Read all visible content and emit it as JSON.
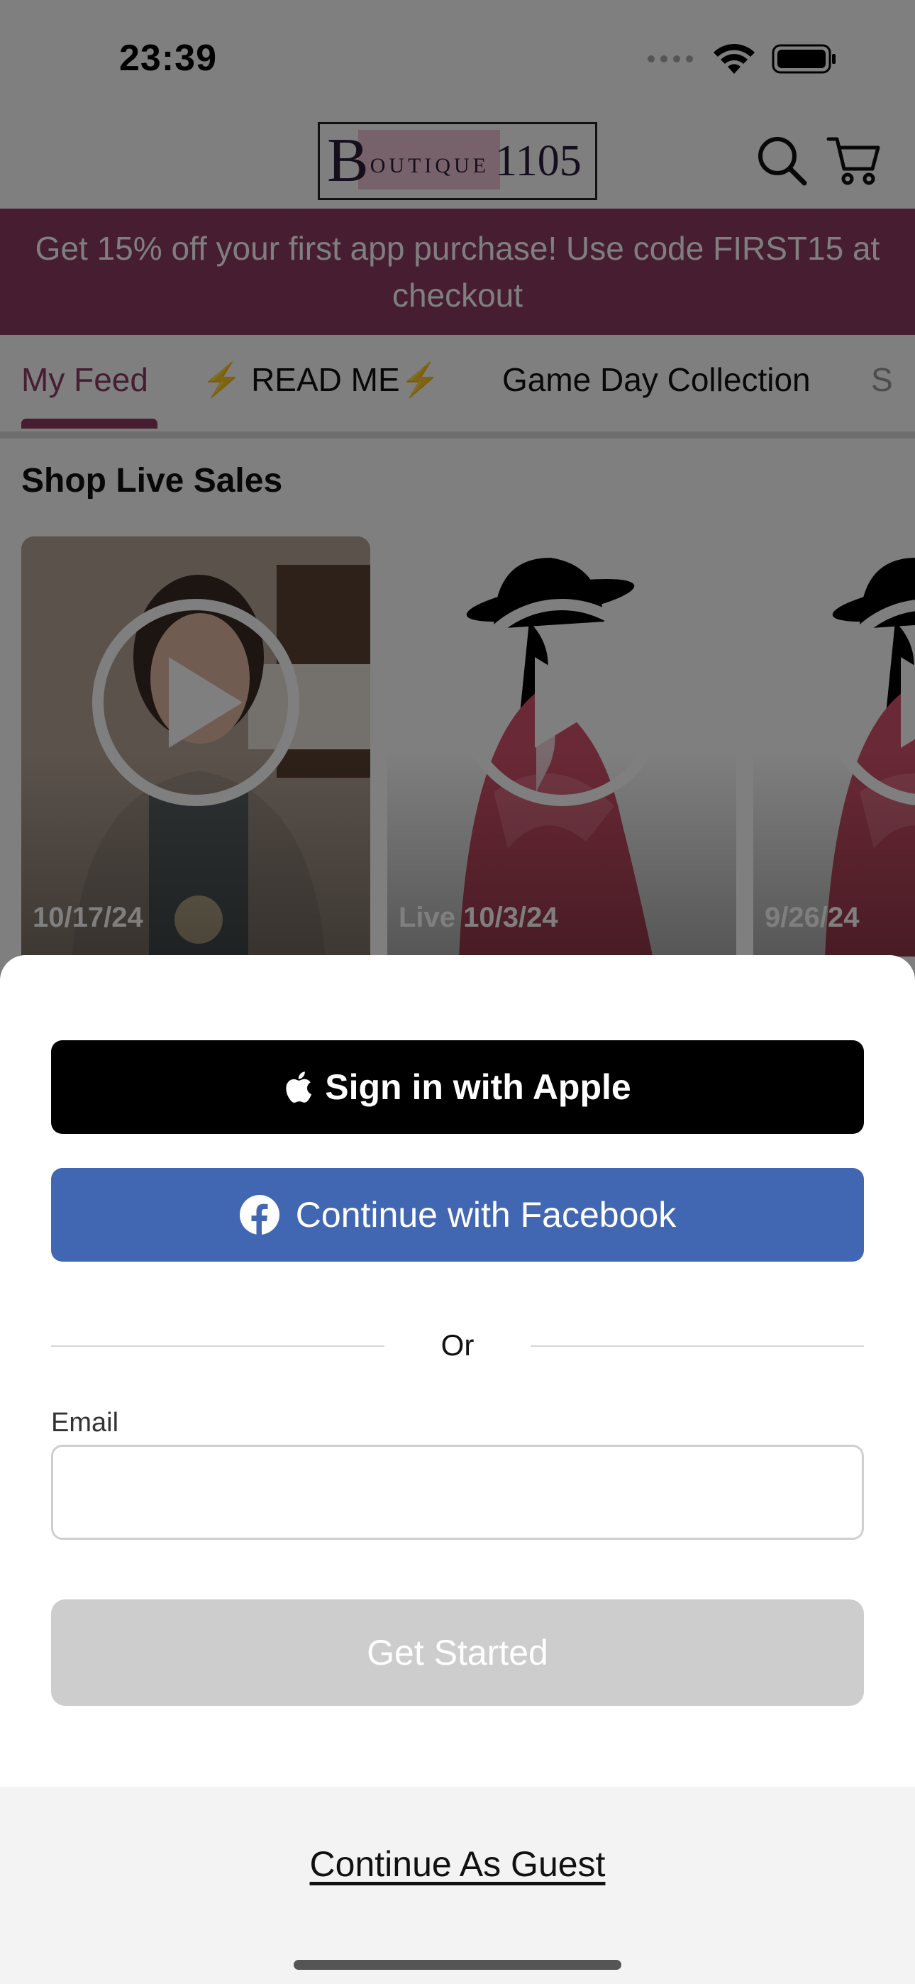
{
  "status_bar": {
    "time": "23:39"
  },
  "header": {
    "logo": {
      "initial": "B",
      "word": "OUTIQUE",
      "number": "1105"
    },
    "search_icon": "search-icon",
    "cart_icon": "cart-icon"
  },
  "promo": {
    "text": "Get 15% off your first app purchase!  Use code FIRST15 at checkout"
  },
  "tabs": {
    "items": [
      {
        "label": "My Feed",
        "active": true
      },
      {
        "label": "READ ME",
        "prefix_icon": "⚡",
        "suffix_icon": "⚡"
      },
      {
        "label": "Game Day Collection"
      },
      {
        "label": "S"
      }
    ]
  },
  "live_sales": {
    "title": "Shop Live Sales",
    "videos": [
      {
        "date": "10/17/24"
      },
      {
        "date": "Live 10/3/24"
      },
      {
        "date": "9/26/24"
      }
    ]
  },
  "auth_sheet": {
    "apple_label": "Sign in with Apple",
    "facebook_label": "Continue with Facebook",
    "divider_text": "Or",
    "email_label": "Email",
    "email_value": "",
    "get_started_label": "Get Started",
    "guest_label": "Continue As Guest"
  },
  "colors": {
    "brand": "#8e3a63",
    "facebook": "#4267b2",
    "apple": "#000000",
    "disabled_button": "#cdcdcd"
  }
}
